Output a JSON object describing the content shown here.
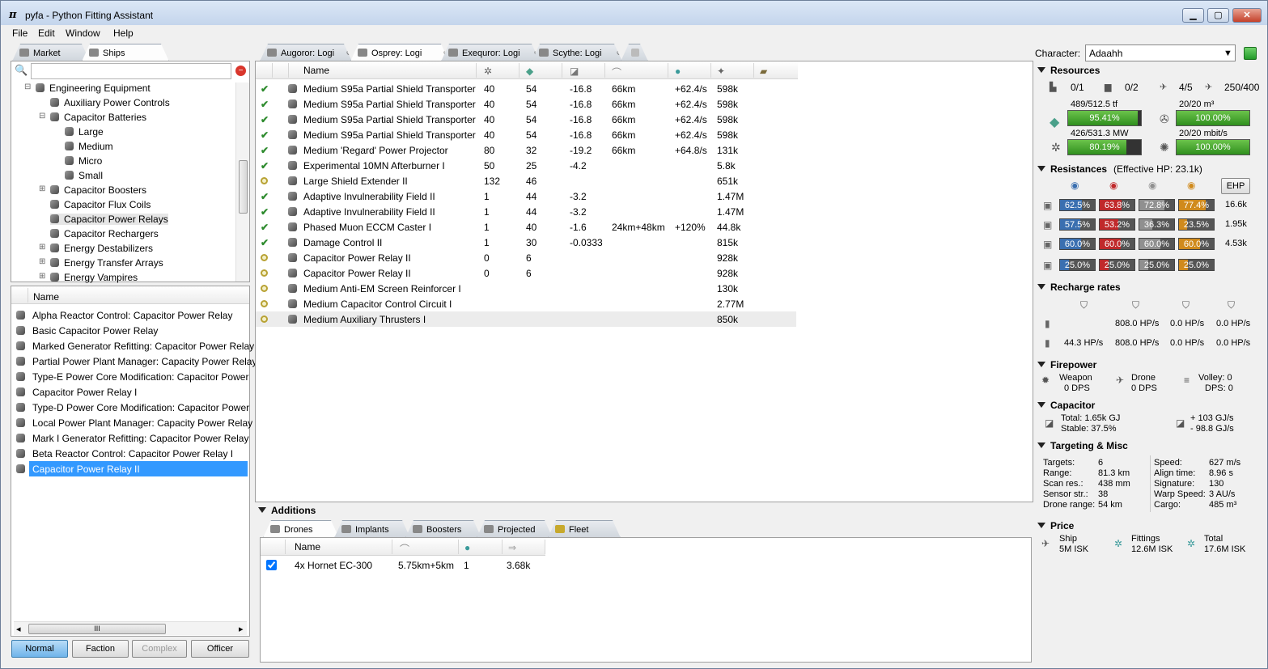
{
  "window": {
    "title": "pyfa - Python Fitting Assistant",
    "min": "▁",
    "max": "▢",
    "close": "✕"
  },
  "menu": [
    "File",
    "Edit",
    "Window",
    "Help"
  ],
  "left": {
    "tabs": [
      {
        "label": "Market",
        "icon": "market-icon"
      },
      {
        "label": "Ships",
        "icon": "ships-icon"
      }
    ],
    "search_placeholder": "",
    "tree": [
      {
        "label": "Engineering Equipment",
        "level": 0,
        "exp": "⊟"
      },
      {
        "label": "Auxiliary Power Controls",
        "level": 1,
        "exp": ""
      },
      {
        "label": "Capacitor Batteries",
        "level": 1,
        "exp": "⊟"
      },
      {
        "label": "Large",
        "level": 2,
        "exp": ""
      },
      {
        "label": "Medium",
        "level": 2,
        "exp": ""
      },
      {
        "label": "Micro",
        "level": 2,
        "exp": ""
      },
      {
        "label": "Small",
        "level": 2,
        "exp": ""
      },
      {
        "label": "Capacitor Boosters",
        "level": 1,
        "exp": "⊞"
      },
      {
        "label": "Capacitor Flux Coils",
        "level": 1,
        "exp": ""
      },
      {
        "label": "Capacitor Power Relays",
        "level": 1,
        "exp": "",
        "sel": true
      },
      {
        "label": "Capacitor Rechargers",
        "level": 1,
        "exp": ""
      },
      {
        "label": "Energy Destabilizers",
        "level": 1,
        "exp": "⊞"
      },
      {
        "label": "Energy Transfer Arrays",
        "level": 1,
        "exp": "⊞"
      },
      {
        "label": "Energy Vampires",
        "level": 1,
        "exp": "⊞"
      }
    ],
    "list_header": "Name",
    "items": [
      "Alpha Reactor Control: Capacitor Power Relay",
      "Basic Capacitor Power Relay",
      "Marked Generator Refitting: Capacitor Power Relay",
      "Partial Power Plant Manager: Capacity Power Relay",
      "Type-E Power Core Modification: Capacitor Power",
      "Capacitor Power Relay I",
      "Type-D Power Core Modification: Capacitor Power",
      "Local Power Plant Manager: Capacity Power Relay",
      "Mark I Generator Refitting: Capacitor Power Relay",
      "Beta Reactor Control: Capacitor Power Relay I",
      "Capacitor Power Relay II"
    ],
    "selected_item": 10,
    "scroll_grip": "III",
    "buttons": [
      "Normal",
      "Faction",
      "Complex",
      "Officer"
    ]
  },
  "fit_tabs": [
    "Augoror: Logi",
    "Osprey: Logi",
    "Exequror: Logi",
    "Scythe: Logi"
  ],
  "active_fit": 1,
  "modules_header": {
    "name": "Name"
  },
  "modules": [
    {
      "st": "on",
      "name": "Medium S95a Partial Shield Transporter",
      "cpu": "40",
      "pg": "54",
      "cap": "-16.8",
      "range": "66km",
      "extra": "+62.4/s",
      "price": "598k"
    },
    {
      "st": "on",
      "name": "Medium S95a Partial Shield Transporter",
      "cpu": "40",
      "pg": "54",
      "cap": "-16.8",
      "range": "66km",
      "extra": "+62.4/s",
      "price": "598k"
    },
    {
      "st": "on",
      "name": "Medium S95a Partial Shield Transporter",
      "cpu": "40",
      "pg": "54",
      "cap": "-16.8",
      "range": "66km",
      "extra": "+62.4/s",
      "price": "598k"
    },
    {
      "st": "on",
      "name": "Medium S95a Partial Shield Transporter",
      "cpu": "40",
      "pg": "54",
      "cap": "-16.8",
      "range": "66km",
      "extra": "+62.4/s",
      "price": "598k"
    },
    {
      "st": "on",
      "name": "Medium 'Regard' Power Projector",
      "cpu": "80",
      "pg": "32",
      "cap": "-19.2",
      "range": "66km",
      "extra": "+64.8/s",
      "price": "131k"
    },
    {
      "st": "on",
      "name": "Experimental 10MN Afterburner I",
      "cpu": "50",
      "pg": "25",
      "cap": "-4.2",
      "range": "",
      "extra": "",
      "price": "5.8k"
    },
    {
      "st": "off",
      "name": "Large Shield Extender II",
      "cpu": "132",
      "pg": "46",
      "cap": "",
      "range": "",
      "extra": "",
      "price": "651k"
    },
    {
      "st": "on",
      "name": "Adaptive Invulnerability Field II",
      "cpu": "1",
      "pg": "44",
      "cap": "-3.2",
      "range": "",
      "extra": "",
      "price": "1.47M"
    },
    {
      "st": "on",
      "name": "Adaptive Invulnerability Field II",
      "cpu": "1",
      "pg": "44",
      "cap": "-3.2",
      "range": "",
      "extra": "",
      "price": "1.47M"
    },
    {
      "st": "on",
      "name": "Phased Muon ECCM Caster I",
      "cpu": "1",
      "pg": "40",
      "cap": "-1.6",
      "range": "24km+48km",
      "extra": "+120%",
      "price": "44.8k"
    },
    {
      "st": "on",
      "name": "Damage Control II",
      "cpu": "1",
      "pg": "30",
      "cap": "-0.0333",
      "range": "",
      "extra": "",
      "price": "815k"
    },
    {
      "st": "off",
      "name": "Capacitor Power Relay II",
      "cpu": "0",
      "pg": "6",
      "cap": "",
      "range": "",
      "extra": "",
      "price": "928k"
    },
    {
      "st": "off",
      "name": "Capacitor Power Relay II",
      "cpu": "0",
      "pg": "6",
      "cap": "",
      "range": "",
      "extra": "",
      "price": "928k"
    },
    {
      "st": "off",
      "name": "Medium Anti-EM Screen Reinforcer I",
      "cpu": "",
      "pg": "",
      "cap": "",
      "range": "",
      "extra": "",
      "price": "130k"
    },
    {
      "st": "off",
      "name": "Medium Capacitor Control Circuit I",
      "cpu": "",
      "pg": "",
      "cap": "",
      "range": "",
      "extra": "",
      "price": "2.77M"
    },
    {
      "st": "off",
      "name": "Medium Auxiliary Thrusters I",
      "cpu": "",
      "pg": "",
      "cap": "",
      "range": "",
      "extra": "",
      "price": "850k"
    }
  ],
  "additions": {
    "title": "Additions",
    "tabs": [
      "Drones",
      "Implants",
      "Boosters",
      "Projected",
      "Fleet"
    ],
    "header": "Name",
    "drones": [
      {
        "checked": true,
        "name": "4x Hornet EC-300",
        "range": "5.75km+5km",
        "speed": "1",
        "price": "3.68k"
      }
    ]
  },
  "right": {
    "character_label": "Character:",
    "character": "Adaahh",
    "resources": {
      "title": "Resources",
      "hardpoints": [
        "0/1",
        "0/2",
        "4/5",
        "250/400"
      ],
      "cpu_text": "489/512.5 tf",
      "cpu_pct": "95.41%",
      "cpu_frac": 0.9541,
      "drone_bay": "20/20 m³",
      "drone_bay_pct": "100.00%",
      "drone_bay_frac": 1,
      "pg_text": "426/531.3 MW",
      "pg_pct": "80.19%",
      "pg_frac": 0.8019,
      "bandwidth": "20/20 mbit/s",
      "bandwidth_pct": "100.00%",
      "bandwidth_frac": 1
    },
    "resistances": {
      "title": "Resistances",
      "ehp": "(Effective HP: 23.1k)",
      "ehp_button": "EHP",
      "rows": [
        {
          "vals": [
            "62.5%",
            "63.8%",
            "72.8%",
            "77.4%"
          ],
          "fr": [
            0.625,
            0.638,
            0.728,
            0.774
          ],
          "hp": "16.6k"
        },
        {
          "vals": [
            "57.5%",
            "53.2%",
            "36.3%",
            "23.5%"
          ],
          "fr": [
            0.575,
            0.532,
            0.363,
            0.235
          ],
          "hp": "1.95k"
        },
        {
          "vals": [
            "60.0%",
            "60.0%",
            "60.0%",
            "60.0%"
          ],
          "fr": [
            0.6,
            0.6,
            0.6,
            0.6
          ],
          "hp": "4.53k"
        },
        {
          "vals": [
            "25.0%",
            "25.0%",
            "25.0%",
            "25.0%"
          ],
          "fr": [
            0.25,
            0.25,
            0.25,
            0.25
          ],
          "hp": ""
        }
      ],
      "colors": [
        "#3a6fb0",
        "#c0292b",
        "#909090",
        "#d08a1c"
      ]
    },
    "recharge": {
      "title": "Recharge rates",
      "r1": [
        "808.0 HP/s",
        "0.0 HP/s",
        "0.0 HP/s"
      ],
      "r2": [
        "44.3 HP/s",
        "808.0 HP/s",
        "0.0 HP/s",
        "0.0 HP/s"
      ]
    },
    "firepower": {
      "title": "Firepower",
      "weapon": "Weapon",
      "weapon_dps": "0 DPS",
      "drone": "Drone",
      "drone_dps": "0 DPS",
      "volley": "Volley: 0",
      "dps": "DPS: 0"
    },
    "capacitor": {
      "title": "Capacitor",
      "total": "Total: 1.65k GJ",
      "stable": "Stable: 37.5%",
      "delta_pos": "+ 103 GJ/s",
      "delta_neg": "- 98.8 GJ/s"
    },
    "targeting": {
      "title": "Targeting & Misc",
      "left": [
        [
          "Targets:",
          "6"
        ],
        [
          "Range:",
          "81.3 km"
        ],
        [
          "Scan res.:",
          "438 mm"
        ],
        [
          "Sensor str.:",
          "38"
        ],
        [
          "Drone range:",
          "54 km"
        ]
      ],
      "right": [
        [
          "Speed:",
          "627 m/s"
        ],
        [
          "Align time:",
          "8.96 s"
        ],
        [
          "Signature:",
          "130"
        ],
        [
          "Warp Speed:",
          "3 AU/s"
        ],
        [
          "Cargo:",
          "485 m³"
        ]
      ]
    },
    "price": {
      "title": "Price",
      "ship": "Ship",
      "ship_v": "5M ISK",
      "fittings": "Fittings",
      "fittings_v": "12.6M ISK",
      "total": "Total",
      "total_v": "17.6M ISK"
    }
  }
}
